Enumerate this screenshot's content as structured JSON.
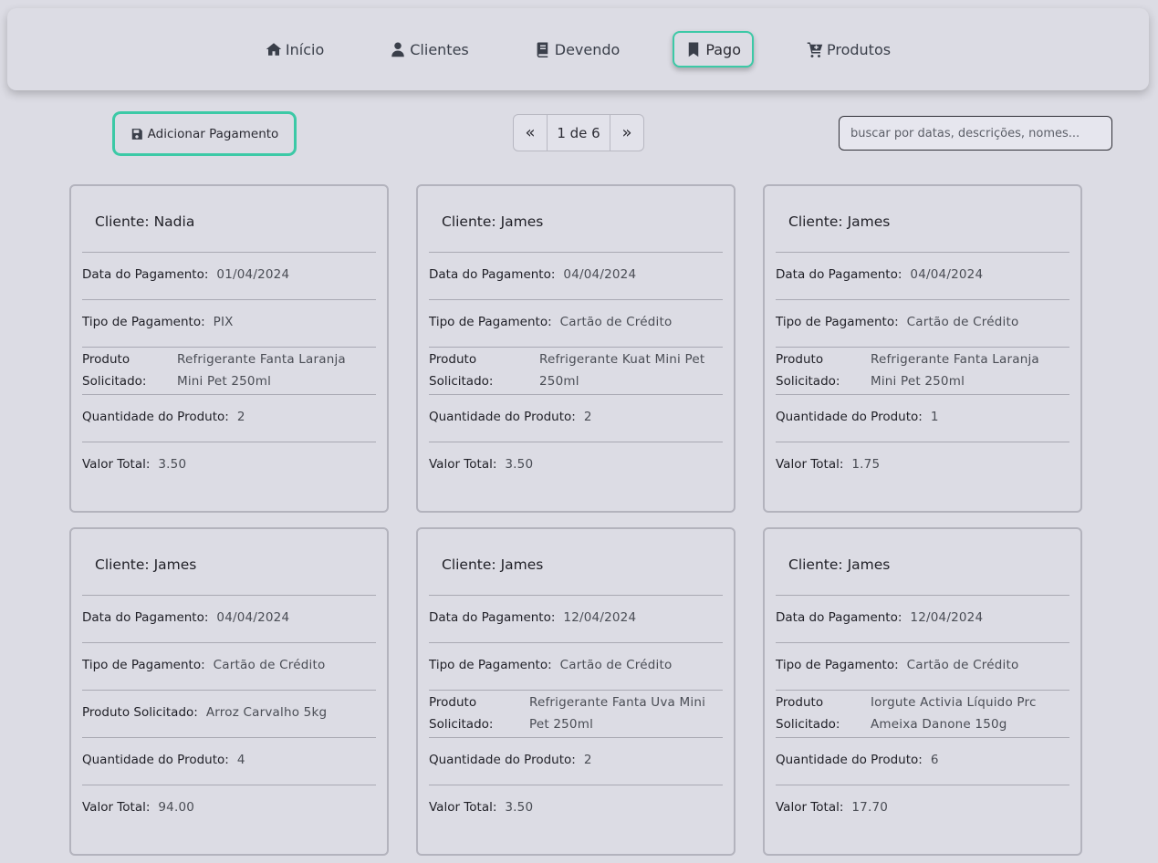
{
  "nav": {
    "items": [
      {
        "label": "Início",
        "icon": "home-icon"
      },
      {
        "label": "Clientes",
        "icon": "user-icon"
      },
      {
        "label": "Devendo",
        "icon": "book-icon"
      },
      {
        "label": "Pago",
        "icon": "bookmark-icon",
        "active": true
      },
      {
        "label": "Produtos",
        "icon": "cart-plus-icon"
      }
    ]
  },
  "toolbar": {
    "add_label": "Adicionar Pagamento",
    "add_icon": "save-icon",
    "pager_prev": "«",
    "pager_page": "1 de 6",
    "pager_next": "»",
    "search_placeholder": "buscar por datas, descrições, nomes..."
  },
  "labels": {
    "cliente": "Cliente:",
    "data": "Data do Pagamento:",
    "tipo": "Tipo de Pagamento:",
    "produto": "Produto Solicitado:",
    "quantidade": "Quantidade do Produto:",
    "valor": "Valor Total:"
  },
  "cards": [
    {
      "cliente": "Nadia",
      "data": "01/04/2024",
      "tipo": "PIX",
      "produto": "Refrigerante Fanta Laranja Mini Pet 250ml",
      "quantidade": "2",
      "valor": "3.50"
    },
    {
      "cliente": "James",
      "data": "04/04/2024",
      "tipo": "Cartão de Crédito",
      "produto": "Refrigerante Kuat Mini Pet 250ml",
      "quantidade": "2",
      "valor": "3.50"
    },
    {
      "cliente": "James",
      "data": "04/04/2024",
      "tipo": "Cartão de Crédito",
      "produto": "Refrigerante Fanta Laranja Mini Pet 250ml",
      "quantidade": "1",
      "valor": "1.75"
    },
    {
      "cliente": "James",
      "data": "04/04/2024",
      "tipo": "Cartão de Crédito",
      "produto": "Arroz Carvalho 5kg",
      "quantidade": "4",
      "valor": "94.00"
    },
    {
      "cliente": "James",
      "data": "12/04/2024",
      "tipo": "Cartão de Crédito",
      "produto": "Refrigerante Fanta Uva Mini Pet 250ml",
      "quantidade": "2",
      "valor": "3.50"
    },
    {
      "cliente": "James",
      "data": "12/04/2024",
      "tipo": "Cartão de Crédito",
      "produto": "Iorgute Activia Líquido Prc Ameixa Danone 150g",
      "quantidade": "6",
      "valor": "17.70"
    }
  ],
  "colors": {
    "accent": "#3cc9a6",
    "background": "#dcdce4"
  }
}
